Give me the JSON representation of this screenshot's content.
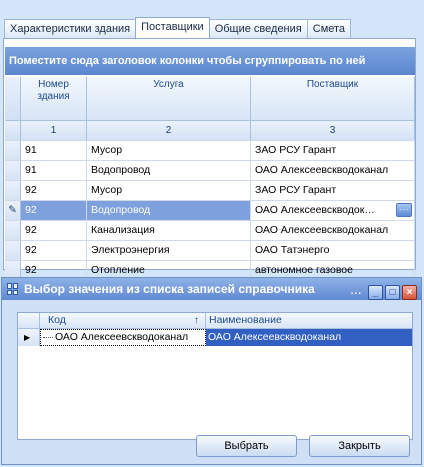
{
  "tabs": [
    {
      "label": "Характеристики здания",
      "active": false
    },
    {
      "label": "Поставщики",
      "active": true
    },
    {
      "label": "Общие сведения",
      "active": false
    },
    {
      "label": "Смета",
      "active": false
    }
  ],
  "group_panel_text": "Поместите сюда заголовок колонки чтобы сгруппировать по ней",
  "grid": {
    "columns": [
      {
        "header_line1": "Номер",
        "header_line2": "здания",
        "number": "1"
      },
      {
        "header_line1": "Услуга",
        "header_line2": "",
        "number": "2"
      },
      {
        "header_line1": "Поставщик",
        "header_line2": "",
        "number": "3"
      }
    ],
    "rows": [
      {
        "indicator": "",
        "building": "91",
        "service": "Мусор",
        "supplier": "ЗАО РСУ Гарант"
      },
      {
        "indicator": "",
        "building": "91",
        "service": "Водопровод",
        "supplier": "ОАО Алексеевскводоканал"
      },
      {
        "indicator": "",
        "building": "92",
        "service": "Мусор",
        "supplier": "ЗАО РСУ Гарант"
      },
      {
        "indicator": "✎",
        "building": "92",
        "service": "Водопровод",
        "supplier": "ОАО Алексеевскводок…",
        "selected": true
      },
      {
        "indicator": "",
        "building": "92",
        "service": "Канализация",
        "supplier": "ОАО Алексеевскводоканал"
      },
      {
        "indicator": "",
        "building": "92",
        "service": "Электроэнергия",
        "supplier": "ОАО Татэнерго"
      },
      {
        "indicator": "",
        "building": "92",
        "service": "Отопление",
        "supplier": "автономное газовое"
      }
    ],
    "ellipsis_label": "···"
  },
  "dialog": {
    "title": "Выбор значения из списка записей справочника",
    "dots": "...",
    "minimize_label": "_",
    "maximize_label": "□",
    "close_label": "×",
    "columns": {
      "code": "Код",
      "name": "Наименование"
    },
    "sort_indicator": "↑",
    "rows": [
      {
        "indicator": "▶",
        "code": "ОАО Алексеевскводоканал",
        "name": "ОАО Алексеевскводоканал"
      }
    ],
    "ok_label": "Выбрать",
    "cancel_label": "Закрыть"
  },
  "colors": {
    "group_panel": "#6b95d8",
    "selected_row": "#7ea0dc",
    "lookup_selected": "#315fc2",
    "dialog_title": "#6f97dc"
  },
  "icons": {
    "row_indicator_edit": "pencil-icon",
    "row_indicator_current": "triangle-right-icon",
    "sort": "arrow-up-icon",
    "dialog": "grid-window-icon"
  }
}
